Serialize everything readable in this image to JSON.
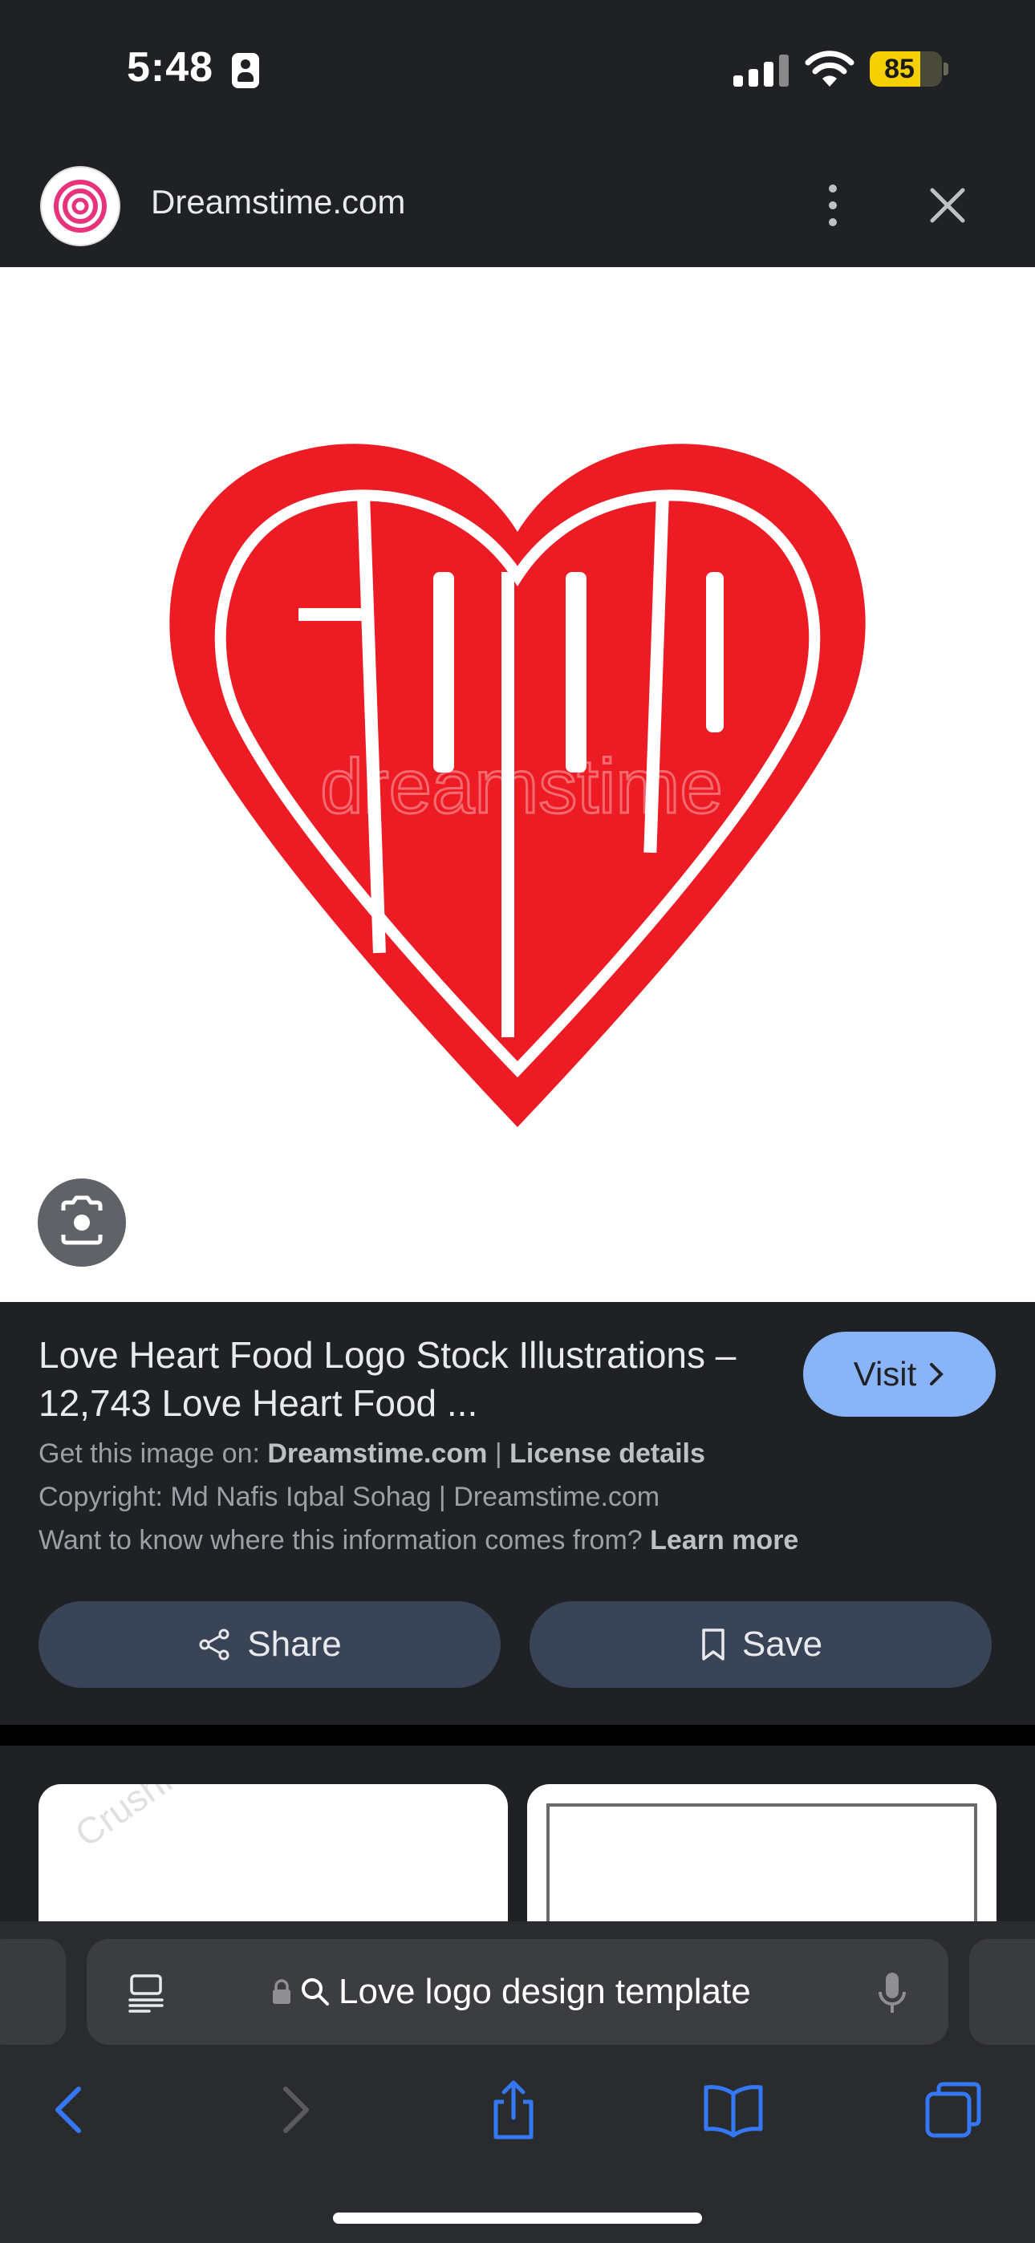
{
  "status_bar": {
    "time": "5:48",
    "battery_level": "85",
    "battery_percent": 85
  },
  "header": {
    "site_title": "Dreamstime.com"
  },
  "image": {
    "logo_text": "FOOD",
    "watermark": "dreamstime"
  },
  "result": {
    "title": "Love Heart Food Logo Stock Illustrations – 12,743 Love Heart Food ...",
    "visit_label": "Visit",
    "source_prefix": "Get this image on: ",
    "source_site": "Dreamstime.com",
    "separator": " | ",
    "license_link": "License details",
    "copyright": "Copyright: Md Nafis Iqbal Sohag | Dreamstime.com",
    "info_question": "Want to know where this information comes from? ",
    "learn_more": "Learn more",
    "share_label": "Share",
    "save_label": "Save"
  },
  "related": {
    "watermark": "CrushPixel"
  },
  "safari": {
    "search_query": "Love logo design template"
  },
  "colors": {
    "accent": "#8ab4f8",
    "logo_red": "#ed1c24",
    "button_bg": "#394457",
    "ios_blue": "#3478f6"
  }
}
